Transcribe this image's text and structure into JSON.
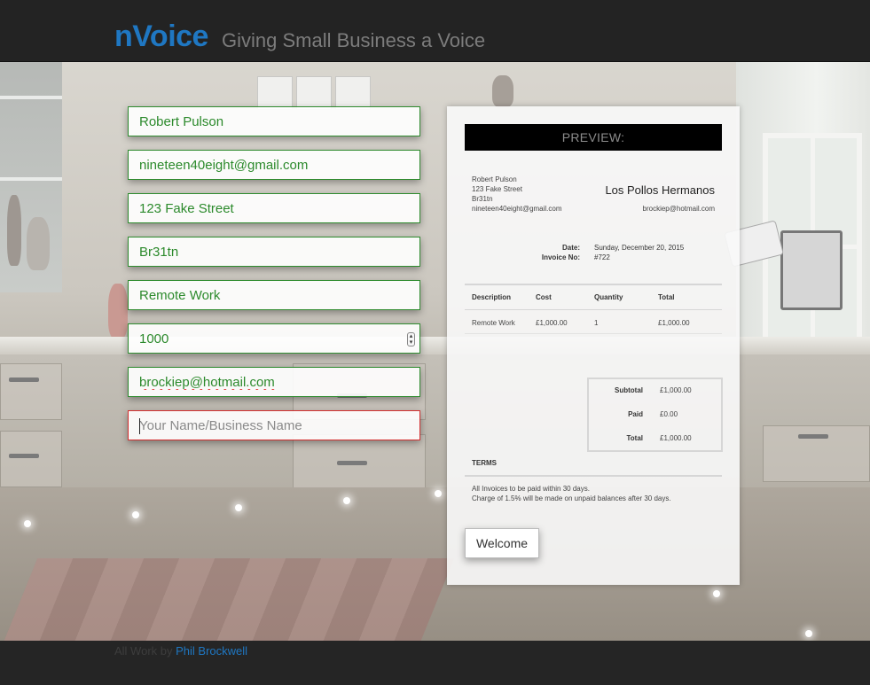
{
  "header": {
    "brand": "nVoice",
    "tagline": "Giving Small Business a Voice"
  },
  "form": {
    "name_value": "Robert Pulson",
    "email_value": "nineteen40eight@gmail.com",
    "street_value": "123 Fake Street",
    "postcode_value": "Br31tn",
    "description_value": "Remote Work",
    "amount_value": "1000",
    "client_email_value": "brockiep@hotmail.com",
    "business_name_placeholder": "Your Name/Business Name",
    "business_name_value": ""
  },
  "invoice": {
    "preview_label": "PREVIEW:",
    "from": {
      "name": "Robert Pulson",
      "street": "123 Fake Street",
      "postcode": "Br31tn",
      "email": "nineteen40eight@gmail.com"
    },
    "to": {
      "name": "Los Pollos Hermanos",
      "email": "brockiep@hotmail.com"
    },
    "meta": {
      "date_label": "Date:",
      "date_value": "Sunday, December 20, 2015",
      "invoice_no_label": "Invoice No:",
      "invoice_no_value": "#722"
    },
    "table": {
      "headers": [
        "Description",
        "Cost",
        "Quantity",
        "Total"
      ],
      "rows": [
        [
          "Remote Work",
          "£1,000.00",
          "1",
          "£1,000.00"
        ]
      ]
    },
    "totals": {
      "subtotal_label": "Subtotal",
      "subtotal_value": "£1,000.00",
      "paid_label": "Paid",
      "paid_value": "£0.00",
      "total_label": "Total",
      "total_value": "£1,000.00"
    },
    "terms": {
      "title": "TERMS",
      "line1": "All Invoices to be paid within 30 days.",
      "line2": "Charge of 1.5% will be made on unpaid balances after 30 days."
    },
    "welcome_button": "Welcome"
  },
  "footer": {
    "credit_prefix": "All Work by",
    "credit_name": "Phil Brockwell"
  },
  "colors": {
    "brand": "#1f77c2",
    "valid_border": "#2e8b2e",
    "invalid_border": "#d32f2f"
  }
}
